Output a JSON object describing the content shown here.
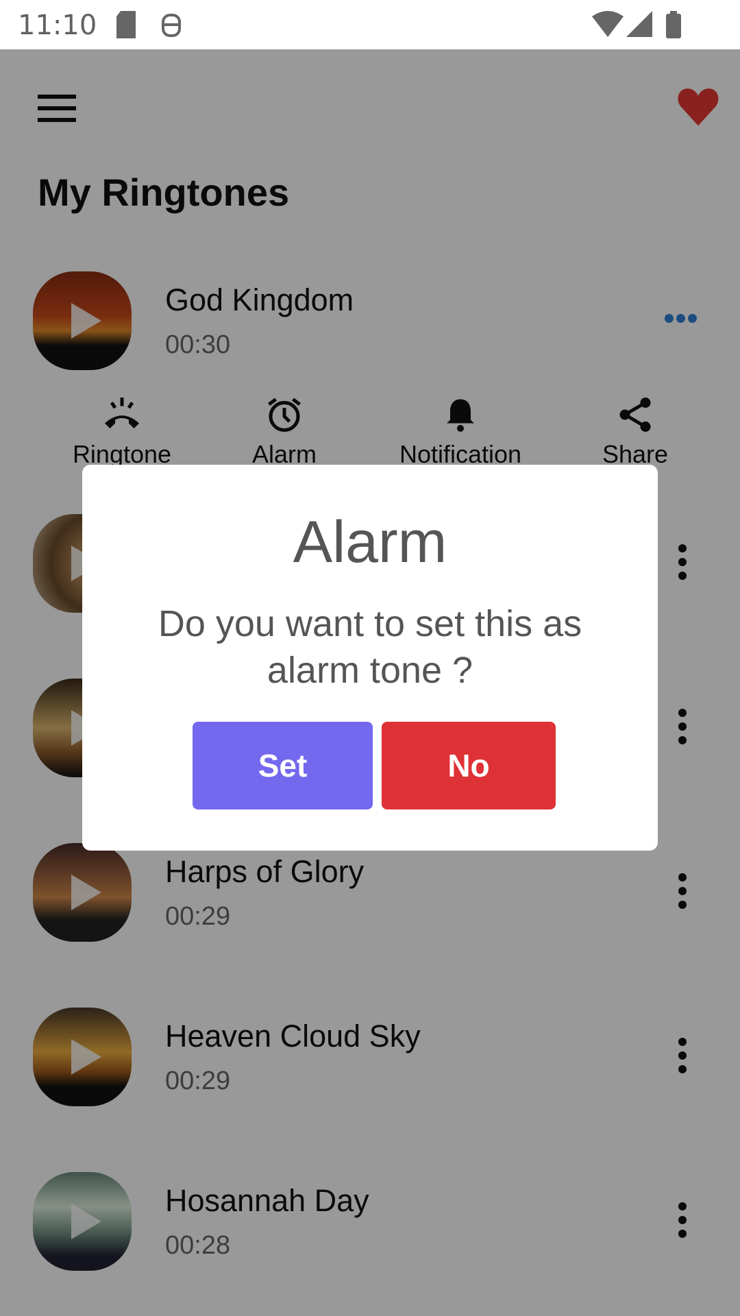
{
  "status_bar": {
    "time": "11:10",
    "icons": [
      "sd-card-icon",
      "android-debug-icon",
      "wifi-icon",
      "signal-icon",
      "battery-icon"
    ]
  },
  "header": {
    "menu_icon": "hamburger-menu-icon",
    "favorite_icon": "heart-icon",
    "title": "My Ringtones"
  },
  "colors": {
    "heart": "#e53935",
    "more": "#2f7fd6",
    "set_button": "#7468ef",
    "no_button": "#df3236"
  },
  "ringtones": [
    {
      "title": "God Kingdom",
      "duration": "00:30",
      "expanded": true
    },
    {
      "title": "",
      "duration": ""
    },
    {
      "title": "",
      "duration": ""
    },
    {
      "title": "Harps of Glory",
      "duration": "00:29"
    },
    {
      "title": "Heaven Cloud Sky",
      "duration": "00:29"
    },
    {
      "title": "Hosannah Day",
      "duration": "00:28"
    }
  ],
  "actions": [
    {
      "label": "Ringtone",
      "icon": "phone-ringing-icon"
    },
    {
      "label": "Alarm",
      "icon": "alarm-clock-icon"
    },
    {
      "label": "Notification",
      "icon": "bell-icon"
    },
    {
      "label": "Share",
      "icon": "share-icon"
    }
  ],
  "dialog": {
    "title": "Alarm",
    "message": "Do you want to set this as alarm tone ?",
    "set_label": "Set",
    "no_label": "No"
  }
}
